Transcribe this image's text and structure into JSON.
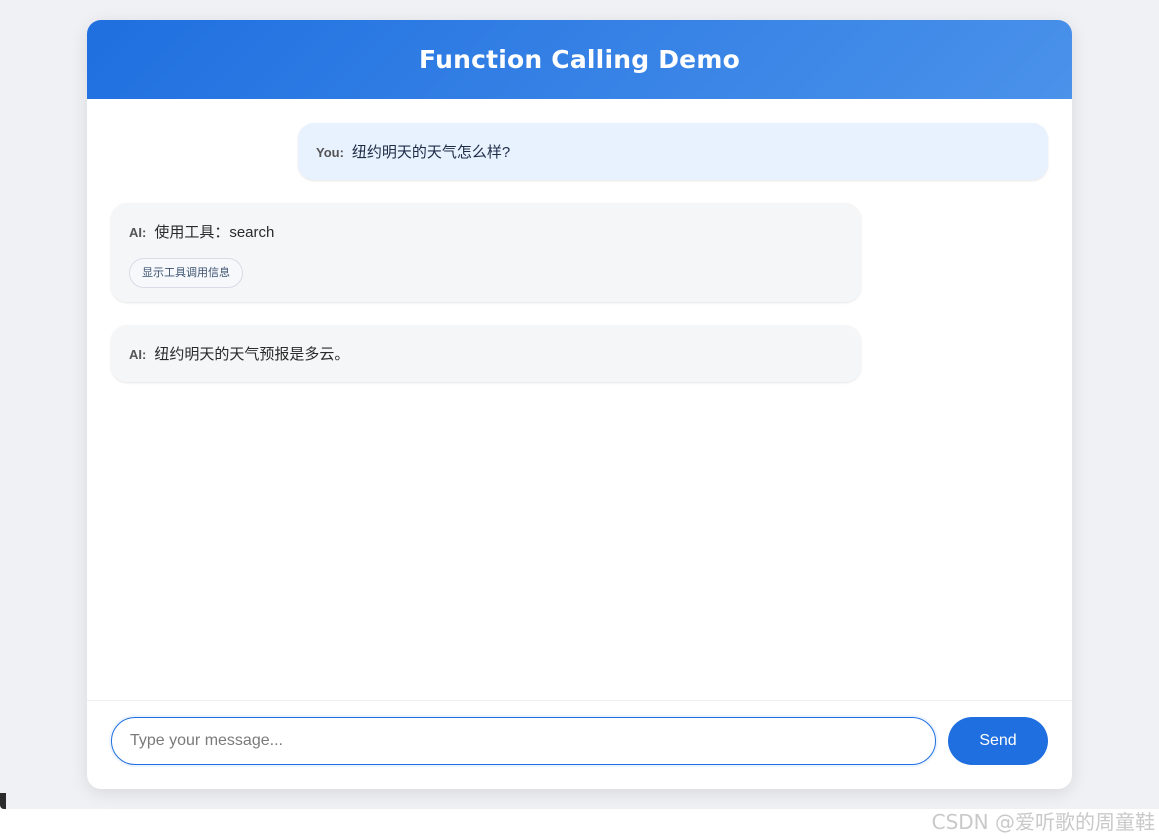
{
  "app": {
    "title": "Function Calling Demo"
  },
  "messages": [
    {
      "sender": "You:",
      "text": "纽约明天的天气怎么样?"
    },
    {
      "sender": "AI:",
      "text": "使用工具：search",
      "tool_button": "显示工具调用信息"
    },
    {
      "sender": "AI:",
      "text": "纽约明天的天气预报是多云。"
    }
  ],
  "input": {
    "value": "",
    "placeholder": "Type your message..."
  },
  "send_label": "Send",
  "watermark": "CSDN @爱听歌的周童鞋",
  "colors": {
    "accent": "#1f6fe0",
    "user_bubble": "#e8f1fe",
    "ai_bubble": "#f5f6f7"
  }
}
